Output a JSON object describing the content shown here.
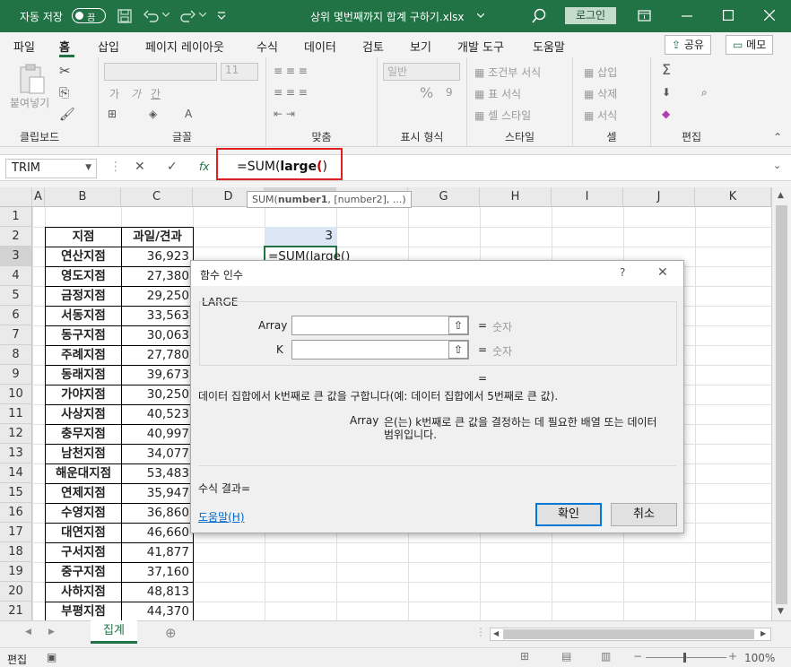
{
  "titlebar": {
    "autosave_label": "자동 저장",
    "autosave_state": "끔",
    "filename": "상위 몇번째까지 합계 구하기.xlsx",
    "login": "로그인"
  },
  "menu": {
    "tabs": [
      "파일",
      "홈",
      "삽입",
      "페이지 레이아웃",
      "수식",
      "데이터",
      "검토",
      "보기",
      "개발 도구",
      "도움말"
    ],
    "active": "홈",
    "share": "공유",
    "memo": "메모"
  },
  "ribbon": {
    "clipboard": {
      "paste": "붙여넣기",
      "label": "클립보드"
    },
    "font": {
      "label": "글꼴",
      "size": "11",
      "bold": "가",
      "italic": "가",
      "underline": "간"
    },
    "align": {
      "label": "맞춤"
    },
    "number": {
      "format": "일반",
      "label": "표시 형식",
      "percent": "%",
      "comma": "9"
    },
    "style": {
      "cond": "조건부 서식",
      "table": "표 서식",
      "cell": "셀 스타일",
      "label": "스타일"
    },
    "cells": {
      "insert": "삽입",
      "delete": "삭제",
      "format": "서식",
      "label": "셀"
    },
    "edit": {
      "label": "편집",
      "sum": "Σ"
    }
  },
  "formula_bar": {
    "name_box": "TRIM",
    "cancel": "✕",
    "enter": "✓",
    "fx": "fx",
    "formula_prefix": "=SUM(",
    "formula_bold": "large",
    "formula_paren": "(",
    "formula_close": ")",
    "tooltip_fn": "SUM(",
    "tooltip_arg1": "number1",
    "tooltip_rest": ", [number2], ...)"
  },
  "columns": [
    "A",
    "B",
    "C",
    "D",
    "E",
    "F",
    "G",
    "H",
    "I",
    "J",
    "K"
  ],
  "rows": [
    "1",
    "2",
    "3",
    "4",
    "5",
    "6",
    "7",
    "8",
    "9",
    "10",
    "11",
    "12",
    "13",
    "14",
    "15",
    "16",
    "17",
    "18",
    "19",
    "20",
    "21"
  ],
  "table": {
    "header_branch": "지점",
    "header_result": "과일/견과",
    "branches": [
      "연산지점",
      "영도지점",
      "금정지점",
      "서동지점",
      "동구지점",
      "주례지점",
      "동래지점",
      "가야지점",
      "사상지점",
      "충무지점",
      "남천지점",
      "해운대지점",
      "연제지점",
      "수영지점",
      "대연지점",
      "구서지점",
      "중구지점",
      "사하지점",
      "부평지점"
    ],
    "values": [
      "36,923",
      "27,380",
      "29,250",
      "33,563",
      "30,063",
      "27,780",
      "39,673",
      "30,250",
      "40,523",
      "40,997",
      "34,077",
      "53,483",
      "35,947",
      "36,860",
      "46,660",
      "41,877",
      "37,160",
      "48,813",
      "44,370"
    ]
  },
  "cells": {
    "E2": "3",
    "E3": "=SUM(large()"
  },
  "dialog": {
    "title": "함수 인수",
    "help_q": "?",
    "close": "✕",
    "fn": "LARGE",
    "args": [
      {
        "name": "Array",
        "result": "숫자"
      },
      {
        "name": "K",
        "result": "숫자"
      }
    ],
    "eq": "=",
    "desc": "데이터 집합에서 k번째로 큰 값을 구합니다(예: 데이터 집합에서 5번째로 큰 값).",
    "arg_name": "Array",
    "arg_desc_1": "은(는) k번째로 큰 값을 결정하는 데 필요한 배열 또는 데이터",
    "arg_desc_2": "범위입니다.",
    "result_label": "수식 결과=",
    "help_link": "도움말(H)",
    "ok": "확인",
    "cancel": "취소"
  },
  "sheet": {
    "tab": "집계"
  },
  "status": {
    "mode": "편집",
    "zoom": "100%"
  }
}
